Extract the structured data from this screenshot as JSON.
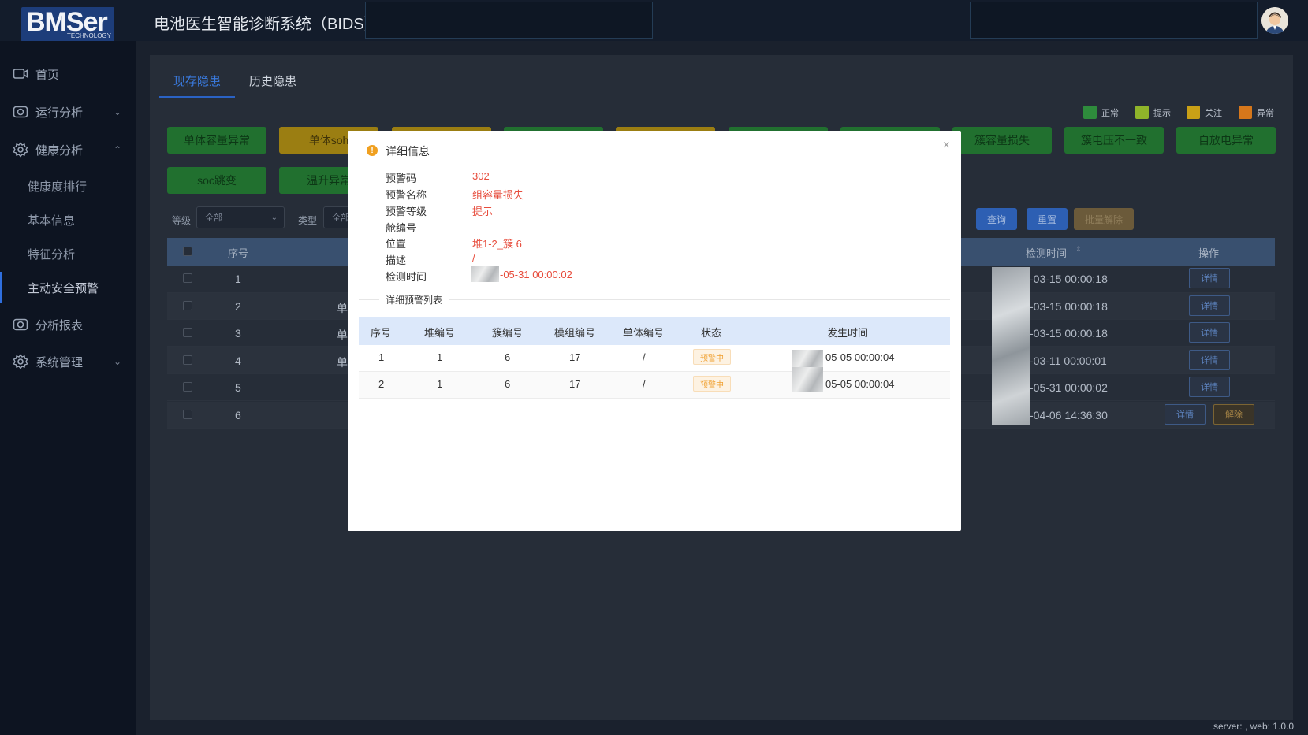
{
  "header": {
    "logo_text": "BMSer",
    "logo_sub": "TECHNOLOGY",
    "title": "电池医生智能诊断系统（BIDS）"
  },
  "sidebar": {
    "items": [
      {
        "label": "首页",
        "icon": "home-icon"
      },
      {
        "label": "运行分析",
        "icon": "camera-icon"
      },
      {
        "label": "健康分析",
        "icon": "gear-icon"
      },
      {
        "label": "分析报表",
        "icon": "camera-icon"
      },
      {
        "label": "系统管理",
        "icon": "gear-icon"
      }
    ],
    "sub_items": [
      "健康度排行",
      "基本信息",
      "特征分析",
      "主动安全预警"
    ]
  },
  "tabs": [
    "现存隐患",
    "历史隐患"
  ],
  "legend": [
    {
      "label": "正常",
      "color": "#2e8b3c"
    },
    {
      "label": "提示",
      "color": "#8fb42a"
    },
    {
      "label": "关注",
      "color": "#c9a016"
    },
    {
      "label": "异常",
      "color": "#d6771b"
    }
  ],
  "filter_buttons": {
    "row1": [
      "单体容量异常",
      "单体soh",
      "",
      "",
      "",
      "",
      "",
      "簇容量损失",
      "簇电压不一致",
      "自放电异常"
    ],
    "row2": [
      "soc跳变",
      "温升异常"
    ]
  },
  "filters": {
    "level_label": "等级",
    "level_value": "全部",
    "type_label": "类型",
    "type_value": "全部"
  },
  "actions": {
    "query": "查询",
    "reset": "重置",
    "batch_release": "批量解除"
  },
  "table": {
    "headers": {
      "index": "序号",
      "detect_time": "检测时间",
      "ops": "操作"
    },
    "rows": [
      {
        "index": "1",
        "mid": "",
        "time": "-03-15 00:00:18"
      },
      {
        "index": "2",
        "mid": "单",
        "time": "-03-15 00:00:18"
      },
      {
        "index": "3",
        "mid": "单",
        "time": "-03-15 00:00:18"
      },
      {
        "index": "4",
        "mid": "单",
        "time": "-03-11 00:00:01"
      },
      {
        "index": "5",
        "mid": "",
        "time": "-05-31 00:00:02"
      },
      {
        "index": "6",
        "mid": "",
        "time": "-04-06 14:36:30"
      }
    ],
    "detail_label": "详情",
    "release_label": "解除"
  },
  "modal": {
    "title": "详细信息",
    "close": "×",
    "fields": [
      {
        "key": "预警码",
        "value": "302"
      },
      {
        "key": "预警名称",
        "value": "组容量损失"
      },
      {
        "key": "预警等级",
        "value": "提示"
      },
      {
        "key": "舱编号",
        "value": ""
      },
      {
        "key": "位置",
        "value": "堆1-2_簇 6"
      },
      {
        "key": "描述",
        "value": "/"
      },
      {
        "key": "检测时间",
        "value": "-05-31 00:00:02"
      }
    ],
    "section_title": "详细预警列表",
    "table_headers": [
      "序号",
      "堆编号",
      "簇编号",
      "模组编号",
      "单体编号",
      "状态",
      "发生时间"
    ],
    "rows": [
      {
        "index": "1",
        "stack": "1",
        "cluster": "6",
        "module": "17",
        "cell": "/",
        "status": "预警中",
        "time": "05-05 00:00:04"
      },
      {
        "index": "2",
        "stack": "1",
        "cluster": "6",
        "module": "17",
        "cell": "/",
        "status": "预警中",
        "time": "05-05 00:00:04"
      }
    ]
  },
  "footer": {
    "version": "server: , web: 1.0.0"
  }
}
